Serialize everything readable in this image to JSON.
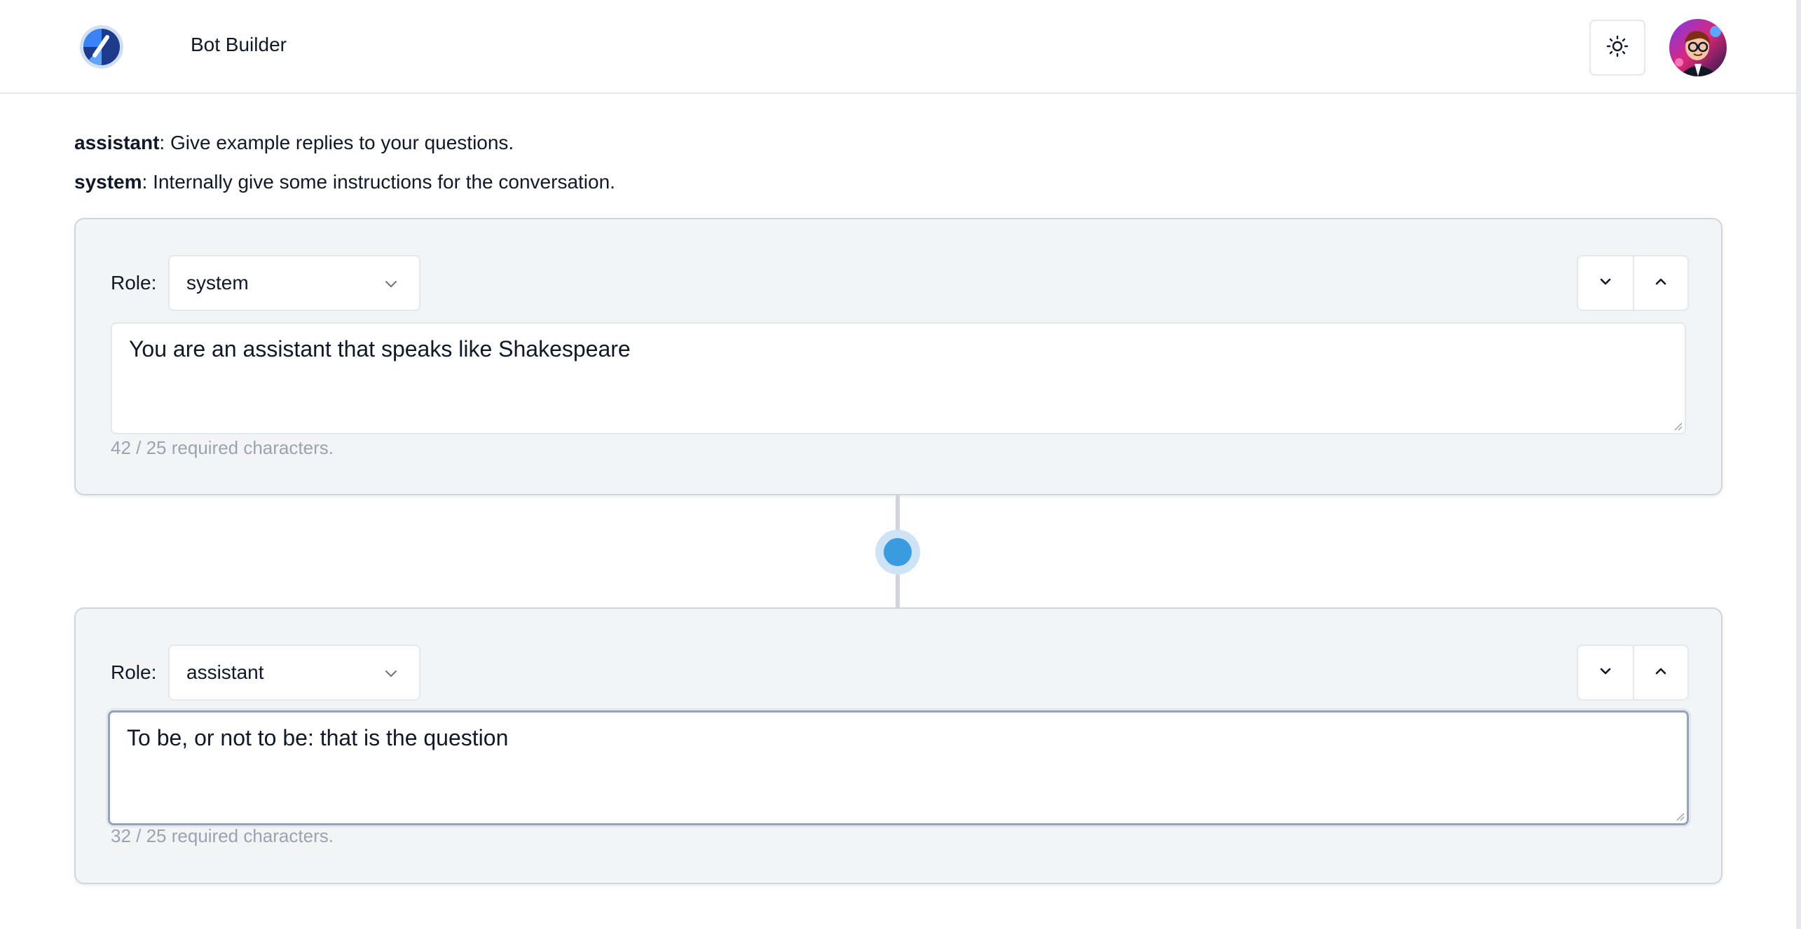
{
  "header": {
    "brand": "Bot Builder",
    "logo_icon": "logo-icon",
    "theme_icon": "sun-icon",
    "avatar_icon": "user-avatar"
  },
  "legend": {
    "assistant_term": "assistant",
    "assistant_desc": ": Give example replies to your questions.",
    "system_term": "system",
    "system_desc": ": Internally give some instructions for the conversation."
  },
  "messages": [
    {
      "role_label": "Role:",
      "role": "system",
      "content": "You are an assistant that speaks like Shakespeare",
      "char_count": "42 / 25 required characters."
    },
    {
      "role_label": "Role:",
      "role": "assistant",
      "content": "To be, or not to be: that is the question",
      "char_count": "32 / 25 required characters."
    }
  ],
  "colors": {
    "card_bg": "#f3f4f6",
    "connector_dot": "#3b9be0",
    "muted_text": "#9ca3af"
  }
}
